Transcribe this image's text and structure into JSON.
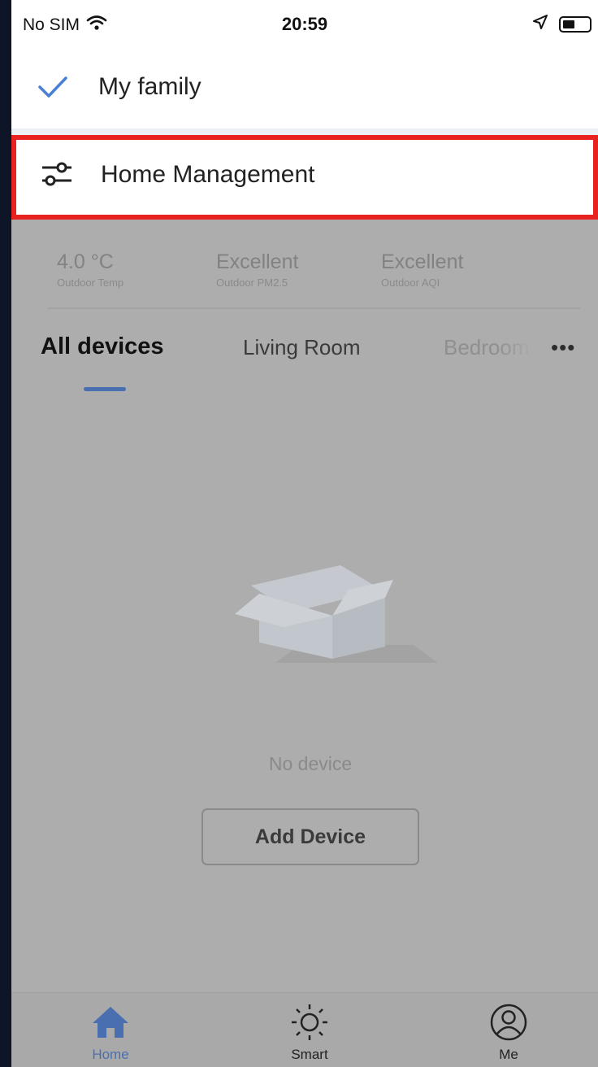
{
  "status_bar": {
    "carrier": "No SIM",
    "time": "20:59",
    "icons": [
      "wifi-icon",
      "location-arrow-icon",
      "battery-icon"
    ]
  },
  "menu": {
    "family_item": {
      "label": "My family",
      "icon": "check-icon",
      "selected": true
    },
    "home_management_item": {
      "label": "Home Management",
      "icon": "sliders-icon"
    },
    "highlight_color": "#e8231f"
  },
  "weather": [
    {
      "value": "4.0 °C",
      "label": "Outdoor Temp"
    },
    {
      "value": "Excellent",
      "label": "Outdoor PM2.5"
    },
    {
      "value": "Excellent",
      "label": "Outdoor AQI"
    }
  ],
  "tabs": {
    "items": [
      "All devices",
      "Living Room",
      "Bedroom"
    ],
    "active": "All devices",
    "more": "•••"
  },
  "empty_state": {
    "message": "No device",
    "button_label": "Add Device"
  },
  "bottom_nav": {
    "items": [
      {
        "label": "Home",
        "icon": "home-icon",
        "active": true
      },
      {
        "label": "Smart",
        "icon": "sun-icon",
        "active": false
      },
      {
        "label": "Me",
        "icon": "user-circle-icon",
        "active": false
      }
    ],
    "accent": "#4a6fb0"
  }
}
